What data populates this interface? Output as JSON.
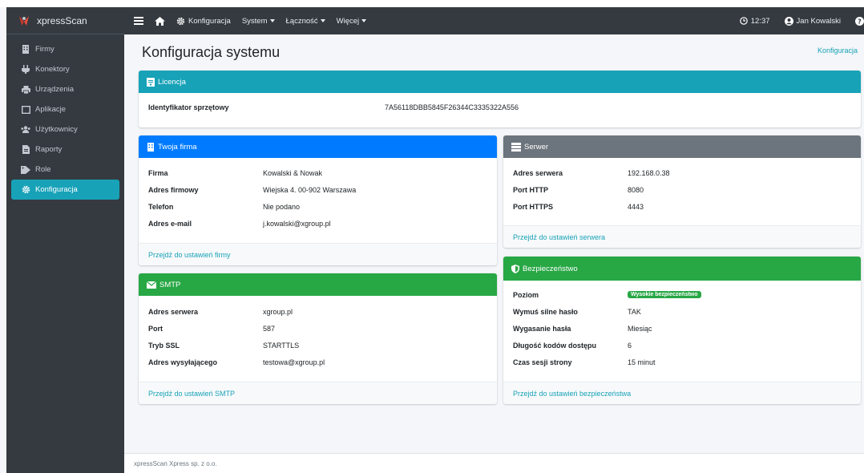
{
  "brand": {
    "name": "xpressScan"
  },
  "sidebar": {
    "items": [
      {
        "label": "Firmy",
        "icon": "building-icon"
      },
      {
        "label": "Konektory",
        "icon": "plug-icon"
      },
      {
        "label": "Urządzenia",
        "icon": "printer-icon"
      },
      {
        "label": "Aplikacje",
        "icon": "window-icon"
      },
      {
        "label": "Użytkownicy",
        "icon": "users-icon"
      },
      {
        "label": "Raporty",
        "icon": "file-icon"
      },
      {
        "label": "Role",
        "icon": "tag-icon"
      },
      {
        "label": "Konfiguracja",
        "icon": "gear-icon",
        "active": true
      }
    ]
  },
  "topbar": {
    "config_label": "Konfiguracja",
    "menus": [
      "System",
      "Łączność",
      "Więcej"
    ],
    "time": "12:37",
    "user": "Jan Kowalski"
  },
  "page": {
    "title": "Konfiguracja systemu",
    "breadcrumb": "Konfiguracja"
  },
  "license": {
    "title": "Licencja",
    "label": "Identyfikator sprzętowy",
    "value": "7A56118DBB5845F26344C3335322A556"
  },
  "company": {
    "title": "Twoja firma",
    "rows": [
      {
        "label": "Firma",
        "value": "Kowalski & Nowak"
      },
      {
        "label": "Adres firmowy",
        "value": "Wiejska 4. 00-902 Warszawa"
      },
      {
        "label": "Telefon",
        "value": "Nie podano"
      },
      {
        "label": "Adres e-mail",
        "value": "j.kowalski@xgroup.pl"
      }
    ],
    "link": "Przejdź do ustawień firmy"
  },
  "server": {
    "title": "Serwer",
    "rows": [
      {
        "label": "Adres serwera",
        "value": "192.168.0.38"
      },
      {
        "label": "Port HTTP",
        "value": "8080"
      },
      {
        "label": "Port HTTPS",
        "value": "4443"
      }
    ],
    "link": "Przejdź do ustawień serwera"
  },
  "smtp": {
    "title": "SMTP",
    "rows": [
      {
        "label": "Adres serwera",
        "value": "xgroup.pl"
      },
      {
        "label": "Port",
        "value": "587"
      },
      {
        "label": "Tryb SSL",
        "value": "STARTTLS"
      },
      {
        "label": "Adres wysyłającego",
        "value": "testowa@xgroup.pl"
      }
    ],
    "link": "Przejdź do ustawień SMTP"
  },
  "security": {
    "title": "Bezpieczeństwo",
    "level_label": "Poziom",
    "level_badge": "Wysokie bezpieczeństwo",
    "rows": [
      {
        "label": "Wymuś silne hasło",
        "value": "TAK"
      },
      {
        "label": "Wygasanie hasła",
        "value": "Miesiąc"
      },
      {
        "label": "Długość kodów dostępu",
        "value": "6"
      },
      {
        "label": "Czas sesji strony",
        "value": "15 minut"
      }
    ],
    "link": "Przejdź do ustawień bezpieczeństwa"
  },
  "footer": {
    "text": "xpressScan Xpress sp. z o.o."
  }
}
